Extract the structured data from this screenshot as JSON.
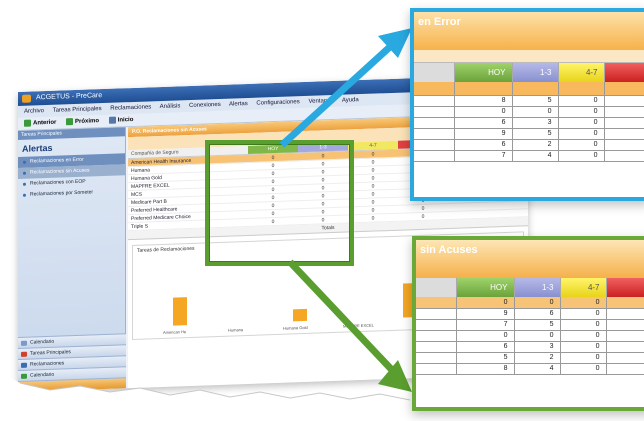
{
  "app": {
    "title": "ACGETUS - PreCare",
    "menu": [
      "Archivo",
      "Tareas Principales",
      "Reclamaciones",
      "Análisis",
      "Conexiones",
      "Alertas",
      "Configuraciones",
      "Ventanas",
      "Ayuda"
    ],
    "toolbar": [
      "Anterior",
      "Próximo",
      "Inicio"
    ]
  },
  "sidebar": {
    "header": "Tareas Principales",
    "title": "Alertas",
    "items": [
      {
        "label": "Reclamaciones en Error"
      },
      {
        "label": "Reclamaciones sin Acuses"
      },
      {
        "label": "Reclamaciones con EOP"
      },
      {
        "label": "Reclamaciones por Someter"
      }
    ],
    "nav": [
      "Calendario",
      "Tareas Principales",
      "Reclamaciones",
      "Calendario"
    ]
  },
  "main": {
    "title": "P.O. Reclamaciones sin Acuses",
    "subtitle": "Presentar en",
    "col_first": "Compañía de Seguro",
    "headers": [
      "HOY",
      "1-3",
      "4-7",
      "8-15"
    ],
    "rows": [
      {
        "name": "American Health Insurance",
        "v": [
          "0",
          "0",
          "0",
          "1"
        ]
      },
      {
        "name": "Humana",
        "v": [
          "0",
          "0",
          "0",
          "0"
        ]
      },
      {
        "name": "Humana Gold",
        "v": [
          "0",
          "0",
          "0",
          "0"
        ]
      },
      {
        "name": "MAPFRE EXCEL",
        "v": [
          "0",
          "0",
          "0",
          "0"
        ]
      },
      {
        "name": "MCS",
        "v": [
          "0",
          "0",
          "0",
          "0"
        ]
      },
      {
        "name": "Medicare Part B",
        "v": [
          "0",
          "0",
          "0",
          "0"
        ]
      },
      {
        "name": "Preferred Healthcare",
        "v": [
          "0",
          "0",
          "0",
          "0"
        ]
      },
      {
        "name": "Preferred Medicare Choice",
        "v": [
          "0",
          "0",
          "0",
          "0"
        ]
      },
      {
        "name": "Triple S",
        "v": [
          "0",
          "0",
          "0",
          "0"
        ]
      }
    ],
    "total_label": "Totals",
    "chart_title": "Tareas de Reclamaciones",
    "chart_x": [
      "American He",
      "Humana",
      "Humana Gold",
      "MAPFRE EXCEL"
    ]
  },
  "zoom_error": {
    "title": "en Error",
    "headers": [
      "HOY",
      "1-3",
      "4-7"
    ],
    "rows": [
      [
        "8",
        "5",
        "0"
      ],
      [
        "0",
        "0",
        "0"
      ],
      [
        "6",
        "3",
        "0"
      ],
      [
        "9",
        "5",
        "0"
      ],
      [
        "6",
        "2",
        "0"
      ],
      [
        "7",
        "4",
        "0"
      ]
    ]
  },
  "zoom_acuses": {
    "title": "sin Acuses",
    "headers": [
      "HOY",
      "1-3",
      "4-7"
    ],
    "rows": [
      [
        "0",
        "0",
        "0"
      ],
      [
        "9",
        "6",
        "0"
      ],
      [
        "7",
        "5",
        "0"
      ],
      [
        "0",
        "0",
        "0"
      ],
      [
        "6",
        "3",
        "0"
      ],
      [
        "5",
        "2",
        "0"
      ],
      [
        "8",
        "4",
        "0"
      ]
    ]
  },
  "colors": {
    "blue_accent": "#29a9e0",
    "green_accent": "#5a9e2f",
    "orange": "#f5a623",
    "hoy_green": "#6ba23a",
    "range_purple": "#8890cf",
    "range_yellow": "#e8d41a",
    "range_red": "#cc2020"
  }
}
